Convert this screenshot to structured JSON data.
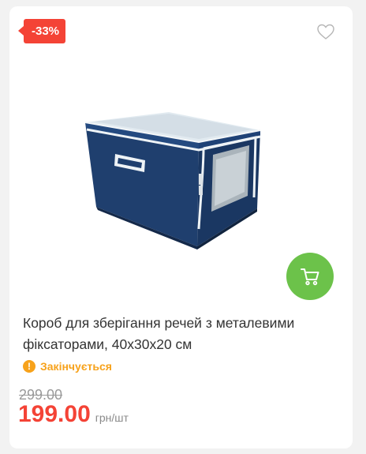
{
  "product": {
    "discount_badge": "-33%",
    "title": "Короб для зберігання речей з металевими фіксаторами, 40х30х20 см",
    "stock_status": "Закінчується",
    "old_price": "299.00",
    "price": "199.00",
    "unit": "грн/шт"
  },
  "colors": {
    "badge": "#f44336",
    "price": "#f44336",
    "cart_button": "#6cc24a",
    "stock_warning": "#f7a21b",
    "box_main": "#1e3f6d",
    "box_lid": "#dfe8ee"
  },
  "icons": {
    "favorite": "heart-outline-icon",
    "cart": "cart-icon",
    "stock": "exclamation-icon"
  }
}
